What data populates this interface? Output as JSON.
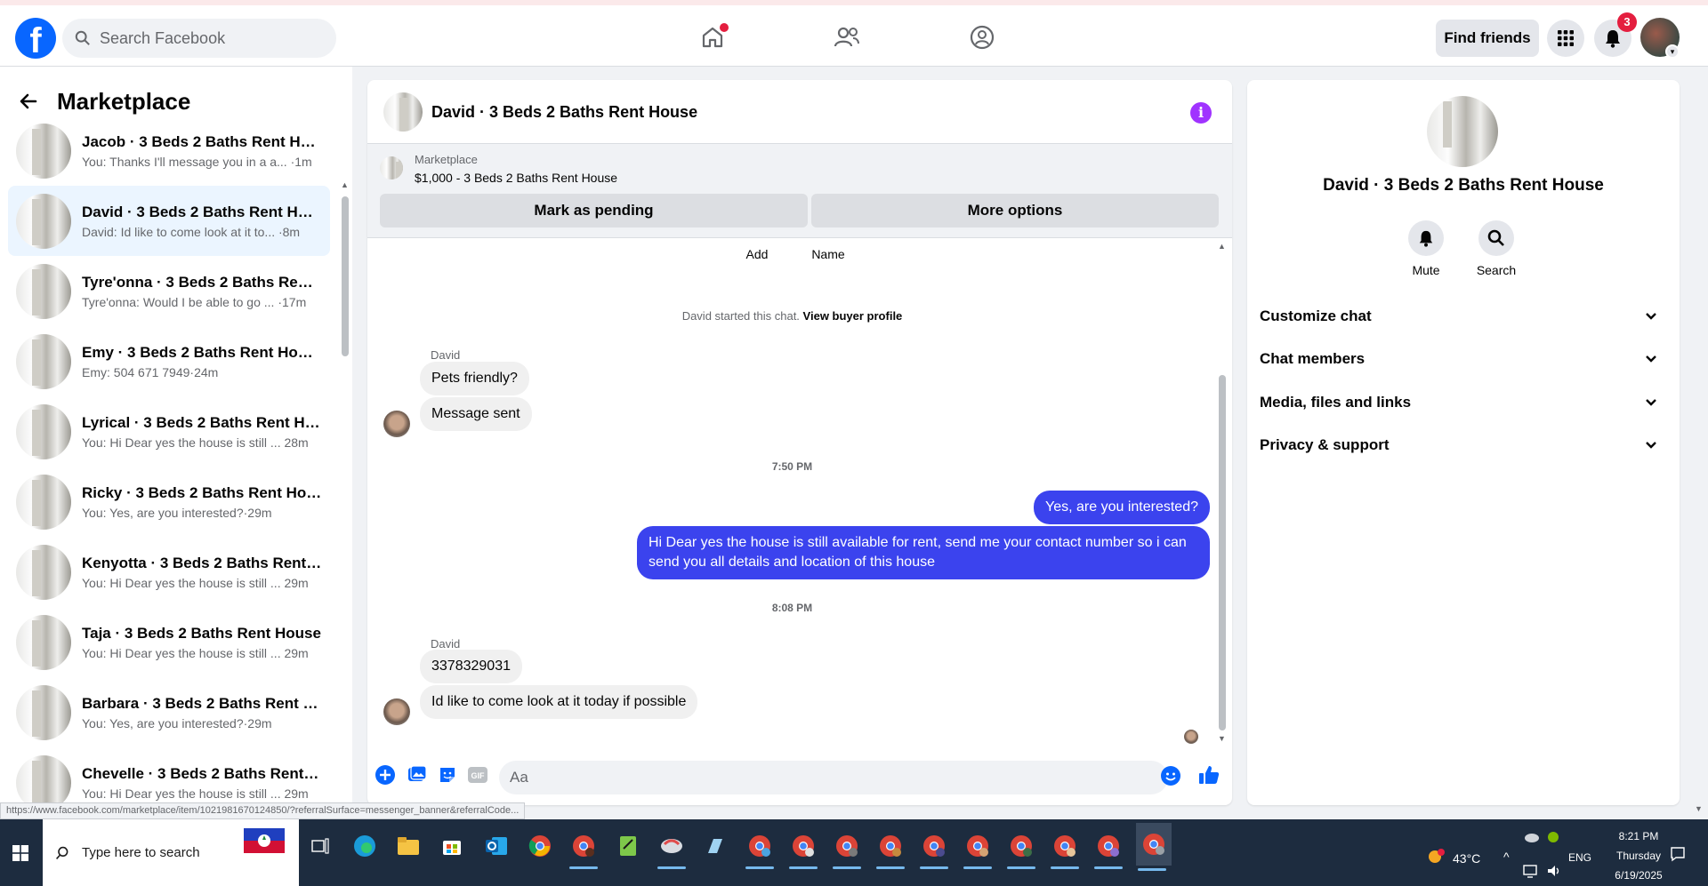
{
  "topbar": {
    "search_placeholder": "Search Facebook",
    "find_friends": "Find friends",
    "notification_count": "3",
    "icons": [
      "facebook-logo",
      "search-icon",
      "home-icon",
      "friends-icon",
      "groups-icon",
      "menu-grid-icon",
      "bell-icon"
    ]
  },
  "sidebar": {
    "title": "Marketplace",
    "conversations": [
      {
        "name": "Jacob · 3 Beds 2 Baths Rent House",
        "snippet": "You: Thanks I'll message you in a a... ·1m"
      },
      {
        "name": "David · 3 Beds 2 Baths Rent House",
        "snippet": "David: Id like to come look at it to... ·8m"
      },
      {
        "name": "Tyre'onna · 3 Beds 2 Baths Rent ...",
        "snippet": "Tyre'onna: Would I be able to go ... ·17m"
      },
      {
        "name": "Emy · 3 Beds 2 Baths Rent House",
        "snippet": "Emy: 504 671 7949·24m"
      },
      {
        "name": "Lyrical · 3 Beds 2 Baths Rent Hou...",
        "snippet": "You: Hi Dear yes the house is still ... 28m"
      },
      {
        "name": "Ricky · 3 Beds 2 Baths Rent House",
        "snippet": "You: Yes, are you interested?·29m"
      },
      {
        "name": "Kenyotta · 3 Beds 2 Baths Rent H...",
        "snippet": "You: Hi Dear yes the house is still ... 29m"
      },
      {
        "name": "Taja · 3 Beds 2 Baths Rent House",
        "snippet": "You: Hi Dear yes the house is still ... 29m"
      },
      {
        "name": "Barbara · 3 Beds 2 Baths Rent H...",
        "snippet": "You: Yes, are you interested?·29m"
      },
      {
        "name": "Chevelle · 3 Beds 2 Baths Rent H...",
        "snippet": "You: Hi Dear yes the house is still ... 29m"
      }
    ]
  },
  "status_url": "https://www.facebook.com/marketplace/item/1021981670124850/?referralSurface=messenger_banner&referralCode...",
  "chat": {
    "title": "David · 3 Beds 2 Baths Rent House",
    "banner": {
      "label": "Marketplace",
      "item": "$1,000 - 3 Beds 2 Baths Rent House",
      "mark_pending": "Mark as pending",
      "more_options": "More options"
    },
    "top_actions": [
      "Add",
      "Name"
    ],
    "started_text": "David started this chat.",
    "view_profile": "View buyer profile",
    "messages": [
      {
        "sender": "David"
      },
      {
        "text": "Pets friendly?"
      },
      {
        "text": "Message sent"
      },
      {
        "time": "7:50 PM"
      },
      {
        "text": "Yes, are you interested?"
      },
      {
        "text": "Hi Dear yes the house is still available for rent, send me your contact number so i can send you all details and location of this house"
      },
      {
        "time": "8:08 PM"
      },
      {
        "sender": "David"
      },
      {
        "text": "3378329031"
      },
      {
        "text": "Id like to come look at it today if possible"
      }
    ],
    "composer_placeholder": "Aa"
  },
  "right_panel": {
    "name": "David · 3 Beds 2 Baths Rent House",
    "actions": [
      "Mute",
      "Search"
    ],
    "sections": [
      "Customize chat",
      "Chat members",
      "Media, files and links",
      "Privacy & support"
    ]
  },
  "taskbar": {
    "search_placeholder": "Type here to search",
    "temperature": "43°C",
    "language": "ENG",
    "time": "8:21 PM",
    "day": "Thursday",
    "date": "6/19/2025"
  },
  "colors": {
    "brand": "#0866ff",
    "outgoing_bubble": "#3b43ee",
    "active_row": "#ebf5ff",
    "taskbar": "#1d2c3f"
  }
}
